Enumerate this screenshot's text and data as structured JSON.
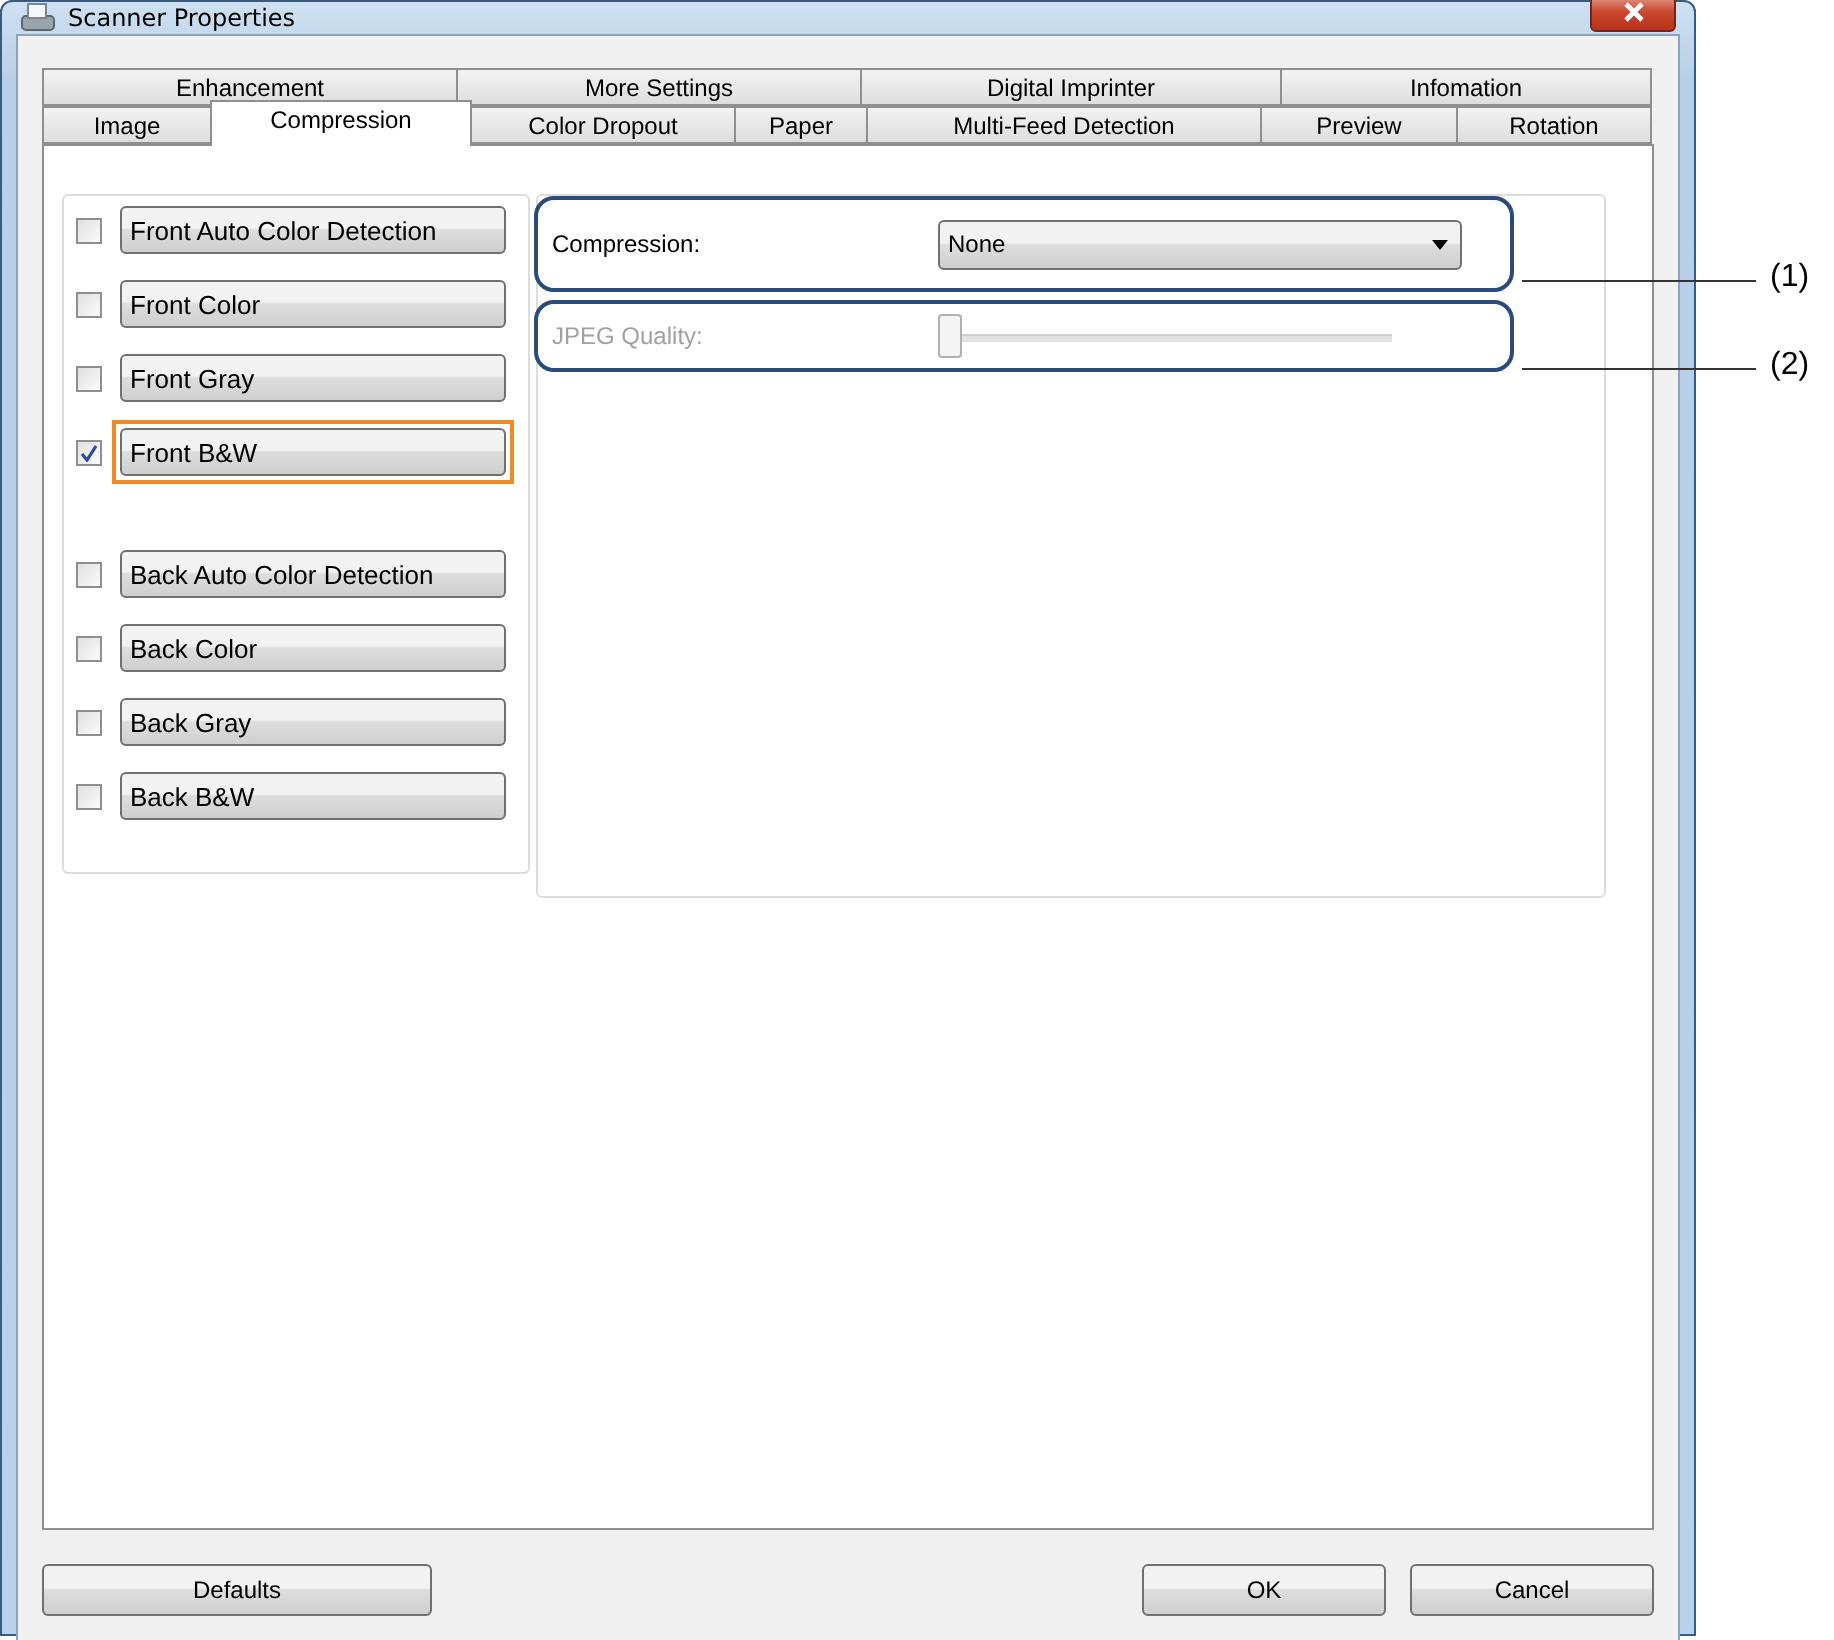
{
  "window": {
    "title": "Scanner Properties"
  },
  "tabs": [
    [
      {
        "label": "Enhancement",
        "selected": false
      },
      {
        "label": "More Settings",
        "selected": false
      },
      {
        "label": "Digital Imprinter",
        "selected": false
      },
      {
        "label": "Infomation",
        "selected": false
      }
    ],
    [
      {
        "label": "Image",
        "selected": false
      },
      {
        "label": "Compression",
        "selected": true
      },
      {
        "label": "Color Dropout",
        "selected": false
      },
      {
        "label": "Paper",
        "selected": false
      },
      {
        "label": "Multi-Feed Detection",
        "selected": false
      },
      {
        "label": "Preview",
        "selected": false
      },
      {
        "label": "Rotation",
        "selected": false
      }
    ]
  ],
  "option_groups": [
    [
      {
        "label": "Front Auto Color Detection",
        "checked": false,
        "focused": false
      },
      {
        "label": "Front Color",
        "checked": false,
        "focused": false
      },
      {
        "label": "Front Gray",
        "checked": false,
        "focused": false
      },
      {
        "label": "Front B&W",
        "checked": true,
        "focused": true
      }
    ],
    [
      {
        "label": "Back Auto Color Detection",
        "checked": false,
        "focused": false
      },
      {
        "label": "Back Color",
        "checked": false,
        "focused": false
      },
      {
        "label": "Back Gray",
        "checked": false,
        "focused": false
      },
      {
        "label": "Back B&W",
        "checked": false,
        "focused": false
      }
    ]
  ],
  "compression": {
    "label": "Compression:",
    "value": "None",
    "callout": "(1)"
  },
  "jpeg_quality": {
    "label": "JPEG Quality:",
    "disabled": true,
    "level": 0,
    "callout": "(2)"
  },
  "footer": {
    "left": [
      "Defaults"
    ],
    "right": [
      "OK",
      "Cancel"
    ]
  }
}
